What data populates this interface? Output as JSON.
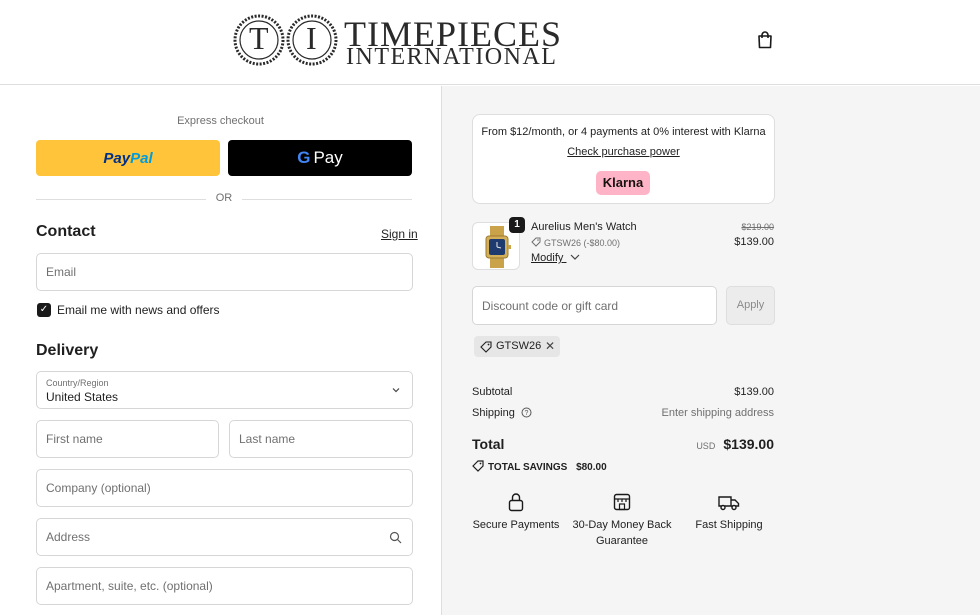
{
  "header": {
    "logo_line1": "TIMEPIECES",
    "logo_line2": "INTERNATIONAL",
    "logo_mark_letters": [
      "T",
      "I"
    ]
  },
  "express": {
    "label": "Express checkout",
    "paypal_a": "Pay",
    "paypal_b": "Pal",
    "gpay_g": "G",
    "gpay_text": "Pay",
    "or": "OR"
  },
  "contact": {
    "heading": "Contact",
    "sign_in": "Sign in",
    "email_placeholder": "Email",
    "newsletter_label": "Email me with news and offers",
    "newsletter_checked": true
  },
  "delivery": {
    "heading": "Delivery",
    "country_label": "Country/Region",
    "country_value": "United States",
    "first_name_placeholder": "First name",
    "last_name_placeholder": "Last name",
    "company_placeholder": "Company (optional)",
    "address_placeholder": "Address",
    "apartment_placeholder": "Apartment, suite, etc. (optional)"
  },
  "klarna": {
    "text": "From $12/month, or 4 payments at 0% interest with Klarna",
    "link": "Check purchase power",
    "badge": "Klarna"
  },
  "product": {
    "quantity": "1",
    "name": "Aurelius Men's Watch",
    "discount": "GTSW26 (-$80.00)",
    "modify": "Modify",
    "price_original": "$219.00",
    "price_current": "$139.00"
  },
  "discount": {
    "placeholder": "Discount code or gift card",
    "apply": "Apply",
    "applied_code": "GTSW26"
  },
  "summary": {
    "subtotal_label": "Subtotal",
    "subtotal_value": "$139.00",
    "shipping_label": "Shipping",
    "shipping_value": "Enter shipping address",
    "total_label": "Total",
    "currency": "USD",
    "total_value": "$139.00",
    "savings_label": "TOTAL SAVINGS",
    "savings_value": "$80.00"
  },
  "features": [
    {
      "label": "Secure Payments",
      "icon": "lock-icon"
    },
    {
      "label": "30-Day Money Back Guarantee",
      "icon": "store-icon"
    },
    {
      "label": "Fast Shipping",
      "icon": "truck-icon"
    }
  ],
  "colors": {
    "paypal_yellow": "#ffc439",
    "klarna_pink": "#ffb3c7",
    "summary_bg": "#f5f5f5"
  }
}
